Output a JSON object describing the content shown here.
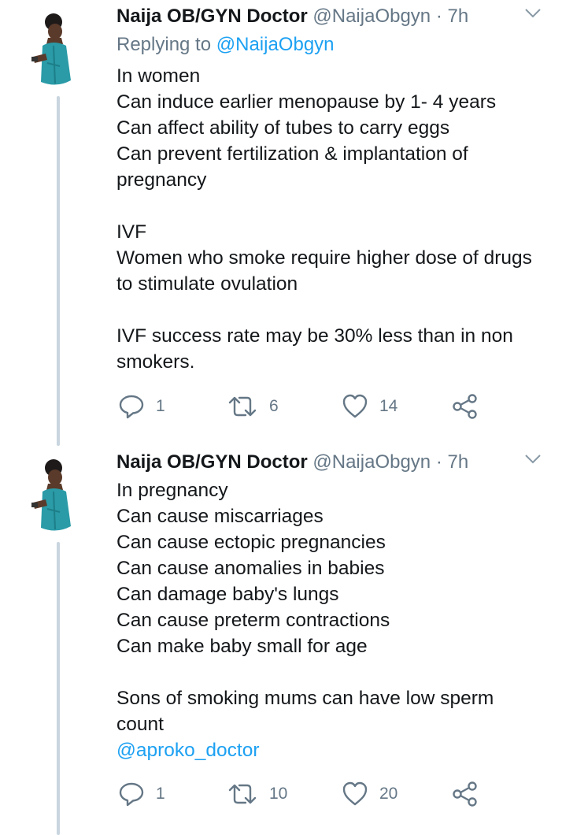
{
  "tweets": [
    {
      "author_name": "Naija OB/GYN Doctor",
      "handle": "@NaijaObgyn",
      "separator": "·",
      "time": "7h",
      "reply_prefix": "Replying to",
      "reply_mention": "@NaijaObgyn",
      "lines": [
        "In women",
        "Can induce earlier menopause by 1- 4 years",
        "Can affect ability of tubes to carry eggs",
        "Can prevent fertilization & implantation of",
        "pregnancy",
        "",
        "IVF",
        "Women who smoke require higher dose of drugs",
        "to stimulate ovulation",
        "",
        "IVF success rate may be 30% less than in non",
        "smokers."
      ],
      "reply_count": "1",
      "retweet_count": "6",
      "like_count": "14"
    },
    {
      "author_name": "Naija OB/GYN Doctor",
      "handle": "@NaijaObgyn",
      "separator": "·",
      "time": "7h",
      "lines": [
        "In pregnancy",
        "Can cause miscarriages",
        "Can cause ectopic pregnancies",
        "Can cause anomalies in babies",
        "Can damage baby's lungs",
        "Can cause preterm contractions",
        "Can make baby small for age",
        "",
        "Sons of smoking mums can have low sperm",
        "count"
      ],
      "mention_line": "@aproko_doctor",
      "reply_count": "1",
      "retweet_count": "10",
      "like_count": "20"
    }
  ],
  "icons": {
    "reply": "reply-icon",
    "retweet": "retweet-icon",
    "like": "heart-icon",
    "share": "share-icon",
    "caret": "chevron-down-icon"
  },
  "colors": {
    "text": "#14171a",
    "muted": "#657786",
    "link": "#1da1f2",
    "thread_line": "#c9d5df"
  }
}
